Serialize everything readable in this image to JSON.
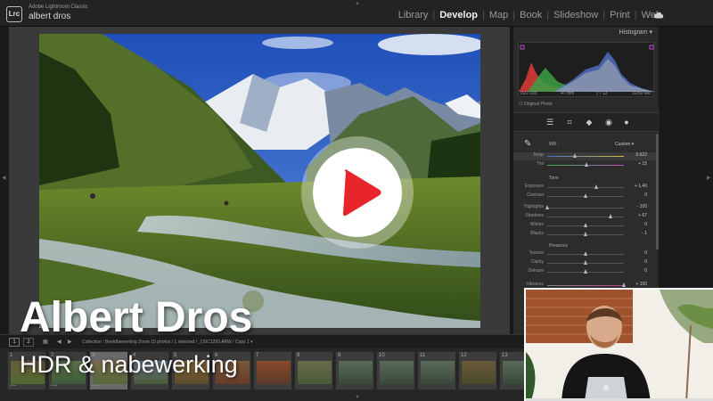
{
  "app": {
    "logo_text": "Lrc",
    "app_name": "Adobe Lightroom Classic",
    "user_name": "albert dros"
  },
  "modules": [
    {
      "label": "Library",
      "active": false
    },
    {
      "label": "Develop",
      "active": true
    },
    {
      "label": "Map",
      "active": false
    },
    {
      "label": "Book",
      "active": false
    },
    {
      "label": "Slideshow",
      "active": false
    },
    {
      "label": "Print",
      "active": false
    },
    {
      "label": "Web",
      "active": false
    }
  ],
  "icons": {
    "cloud": "cloud-icon",
    "play": "play-icon",
    "eyedropper": "eyedropper-icon"
  },
  "colors": {
    "play_red": "#e8252a",
    "panel_bg": "#2c2c2c",
    "active_module": "#f0f0f0"
  },
  "right_panel": {
    "histogram_label": "Histogram",
    "hist_info": {
      "iso": "ISO 100",
      "focal": "47 mm",
      "aperture": "ƒ / 13",
      "shutter": "1/250 sec"
    },
    "original_photo": "Original Photo",
    "wb_label": "WB :",
    "wb_value": "Custom",
    "tone_label": "Tone",
    "presence_label": "Presence",
    "sliders_wb": [
      {
        "label": "Temp",
        "value": "5.622",
        "pos": 0.37,
        "active": true
      },
      {
        "label": "Tint",
        "value": "+ 15",
        "pos": 0.52,
        "active": false
      }
    ],
    "sliders_tone1": [
      {
        "label": "Exposure",
        "value": "+ 1,40",
        "pos": 0.64
      },
      {
        "label": "Contrast",
        "value": "0",
        "pos": 0.5
      }
    ],
    "sliders_tone2": [
      {
        "label": "Highlights",
        "value": "- 100",
        "pos": 0.0
      },
      {
        "label": "Shadows",
        "value": "+ 67",
        "pos": 0.83
      },
      {
        "label": "Whites",
        "value": "0",
        "pos": 0.5
      },
      {
        "label": "Blacks",
        "value": "- 1",
        "pos": 0.5
      }
    ],
    "sliders_presence": [
      {
        "label": "Texture",
        "value": "0",
        "pos": 0.5
      },
      {
        "label": "Clarity",
        "value": "0",
        "pos": 0.5
      },
      {
        "label": "Dehaze",
        "value": "0",
        "pos": 0.5
      }
    ],
    "vibrance": {
      "label": "Vibrance",
      "value": "+ 100",
      "pos": 1.0
    }
  },
  "filmstrip": {
    "pages": [
      "1",
      "2"
    ],
    "path": "Collection : Beeldbewerking Zoom    15 photos / 1 selected / _DSC1293.ARW / Copy 1 ▾",
    "thumbs": [
      "1",
      "2",
      "3",
      "4",
      "5",
      "6",
      "7",
      "8",
      "9",
      "10",
      "11",
      "12",
      "13"
    ]
  },
  "overlay": {
    "title": "Albert Dros",
    "subtitle": "HDR & nabewerking"
  }
}
